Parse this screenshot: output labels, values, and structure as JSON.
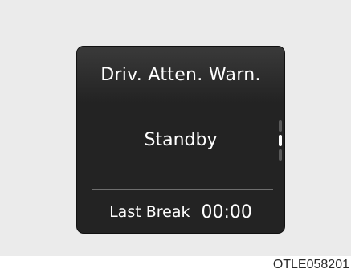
{
  "display": {
    "title": "Driv. Atten. Warn.",
    "status": "Standby",
    "last_break_label": "Last Break",
    "last_break_time": "00:00"
  },
  "scrollbar": {
    "position_index": 1,
    "segment_count": 3
  },
  "figure_code": "OTLE058201",
  "colors": {
    "background": "#ebebeb",
    "screen": "#232323",
    "text": "#ffffff",
    "scroll_active": "#ffffff",
    "scroll_inactive": "#5a5a5a"
  }
}
